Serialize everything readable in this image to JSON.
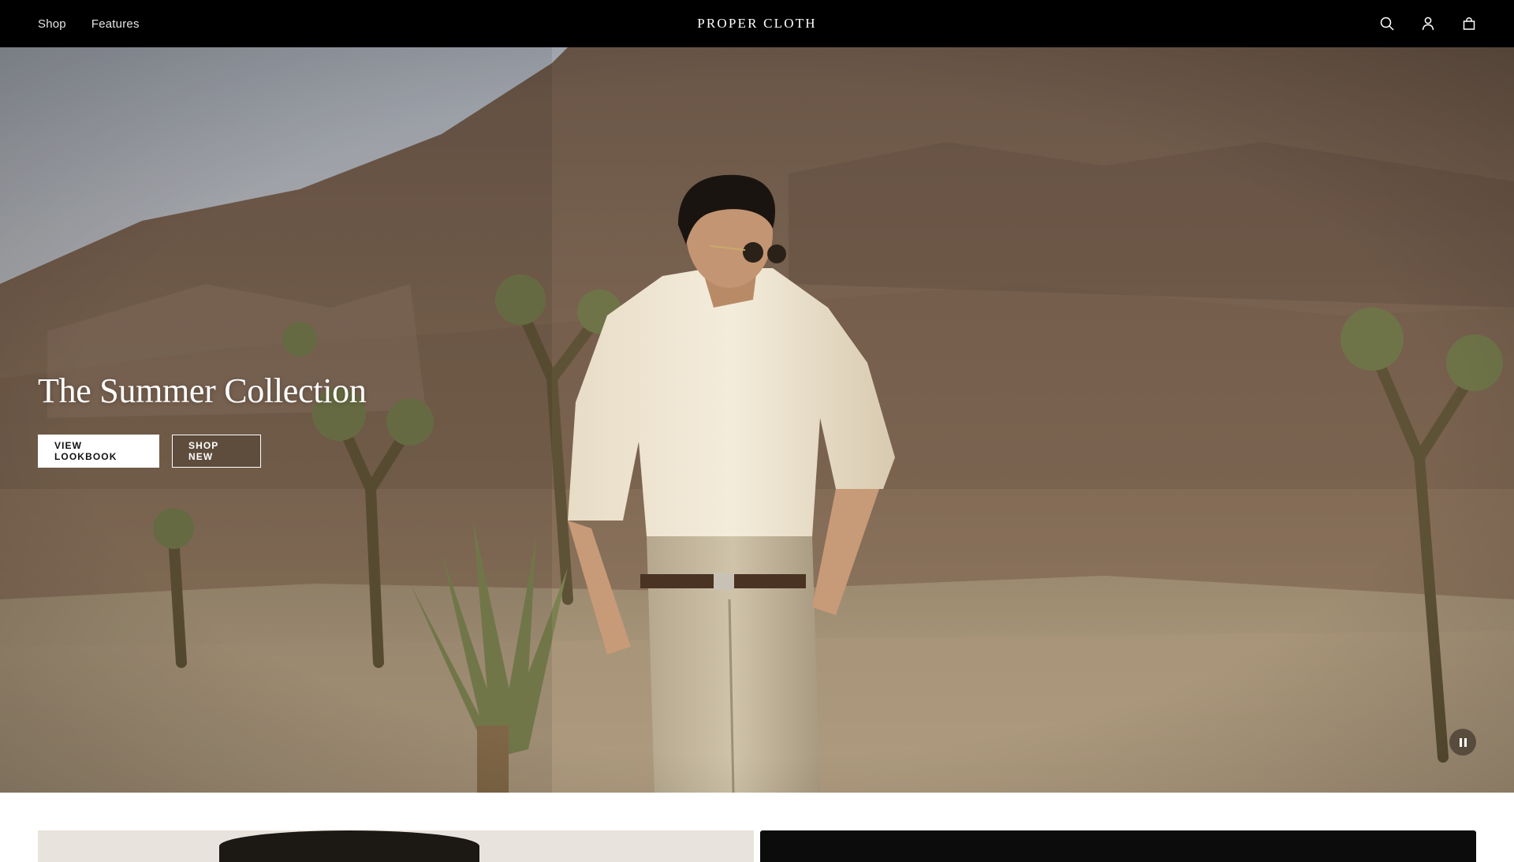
{
  "header": {
    "nav": [
      {
        "label": "Shop"
      },
      {
        "label": "Features"
      }
    ],
    "logo": "PROPER CLOTH",
    "icons": [
      "search-icon",
      "account-icon",
      "bag-icon"
    ]
  },
  "hero": {
    "title": "The Summer Collection",
    "buttons": {
      "lookbook": "VIEW LOOKBOOK",
      "shop_new": "SHOP NEW"
    },
    "pause_icon": "pause-icon"
  },
  "colors": {
    "header_bg": "#000000",
    "header_text": "#ffffff",
    "button_solid_bg": "#ffffff",
    "button_solid_text": "#111111"
  }
}
